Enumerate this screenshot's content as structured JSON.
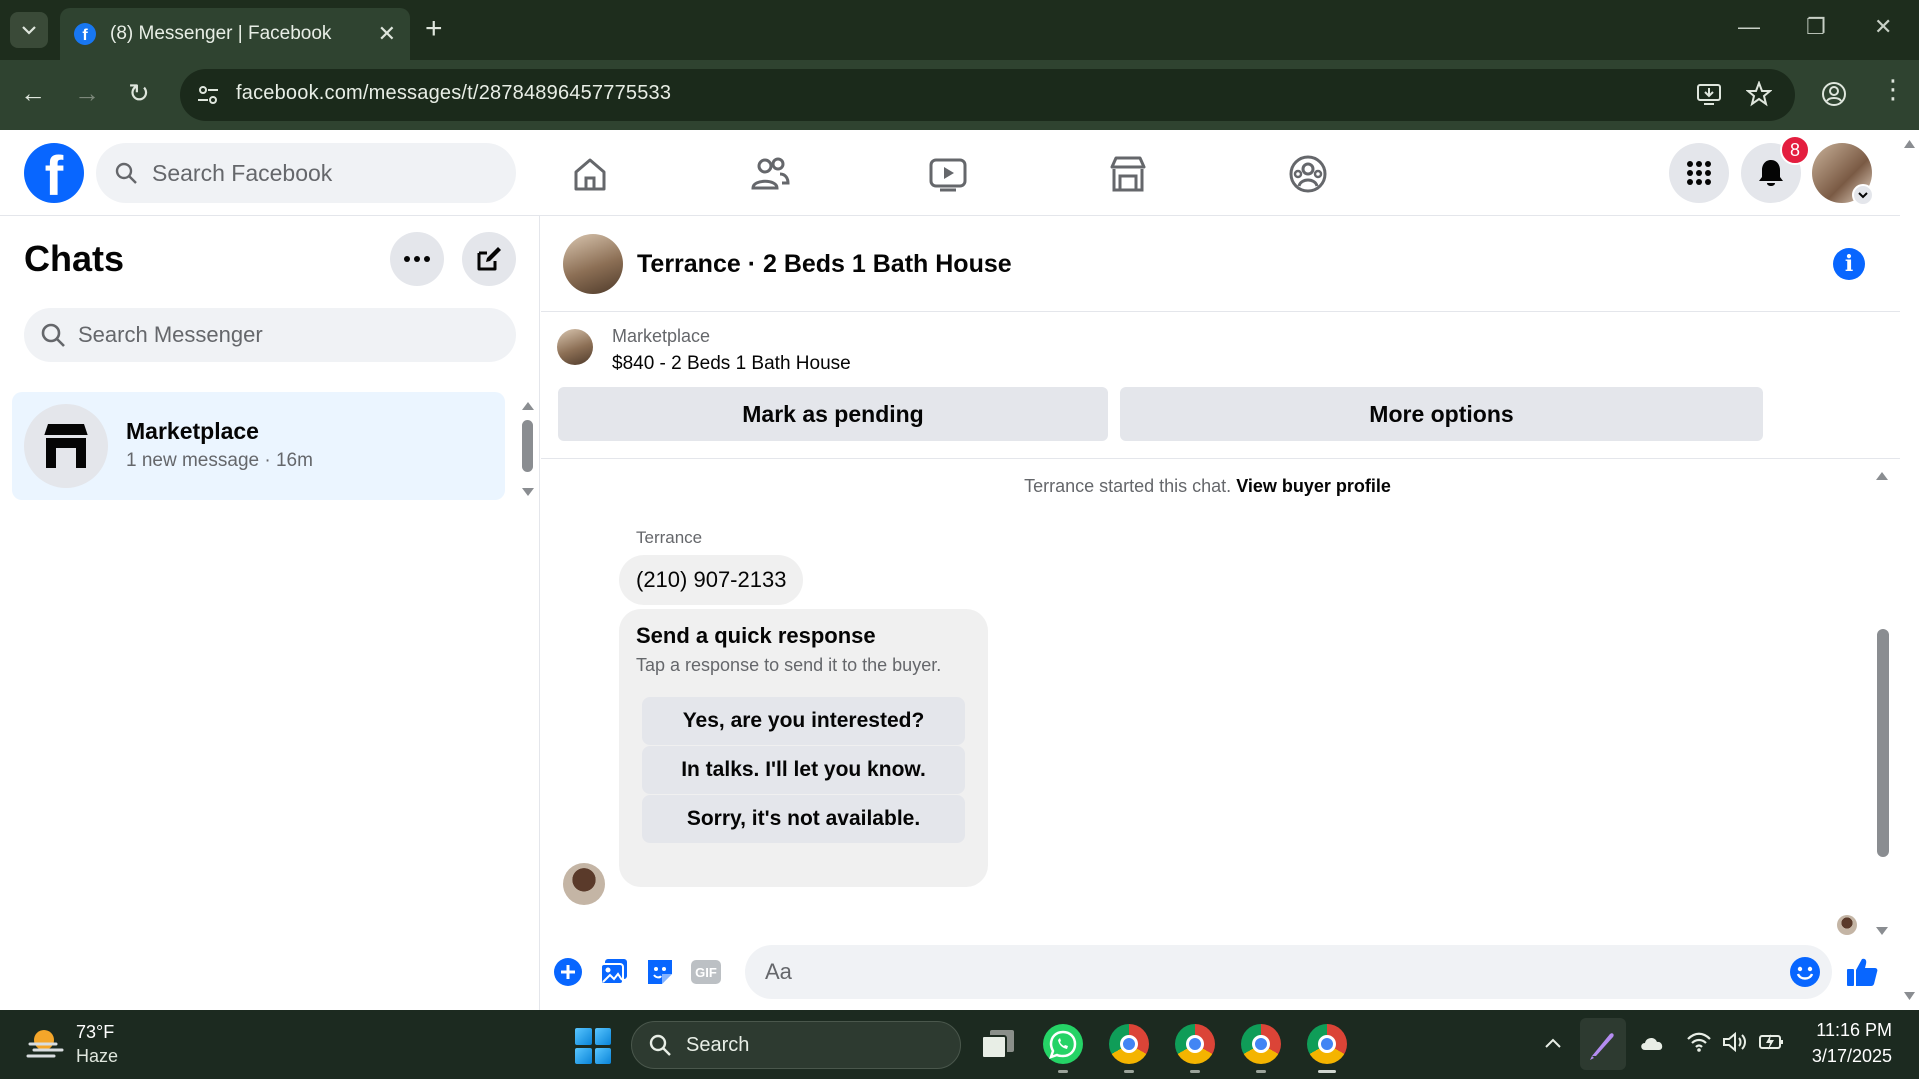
{
  "browser": {
    "tab_title": "(8) Messenger | Facebook",
    "url": "facebook.com/messages/t/28784896457775533",
    "favicon_letter": "f"
  },
  "fb_nav": {
    "logo_letter": "f",
    "search_placeholder": "Search Facebook",
    "notifications_count": "8",
    "icons": [
      "home-icon",
      "friends-icon",
      "watch-icon",
      "marketplace-icon",
      "groups-icon",
      "menu-grid-icon",
      "bell-icon"
    ]
  },
  "sidebar": {
    "title": "Chats",
    "search_placeholder": "Search Messenger",
    "chats": [
      {
        "name": "Marketplace",
        "subtitle": "1 new message · 16m"
      }
    ]
  },
  "conversation": {
    "title": "Terrance · 2 Beds 1 Bath House",
    "listing": {
      "label": "Marketplace",
      "title": "$840 - 2 Beds 1 Bath House",
      "mark_pending_label": "Mark as pending",
      "more_options_label": "More options"
    },
    "started_text": "Terrance started this chat.",
    "view_profile_label": "View buyer profile",
    "sender_name": "Terrance",
    "message": "(210) 907-2133",
    "quick_response": {
      "title": "Send a quick response",
      "subtitle": "Tap a response to send it to the buyer.",
      "options": [
        "Yes, are you interested?",
        "In talks. I'll let you know.",
        "Sorry, it's not available."
      ]
    },
    "composer_placeholder": "Aa"
  },
  "taskbar": {
    "weather_temp": "73°F",
    "weather_desc": "Haze",
    "search_label": "Search",
    "time": "11:16 PM",
    "date": "3/17/2025"
  },
  "colors": {
    "facebook_blue": "#0866ff",
    "badge_red": "#e41e3f",
    "selected_chat_bg": "#ebf5ff",
    "chrome_dark": "#1e2d1d"
  }
}
